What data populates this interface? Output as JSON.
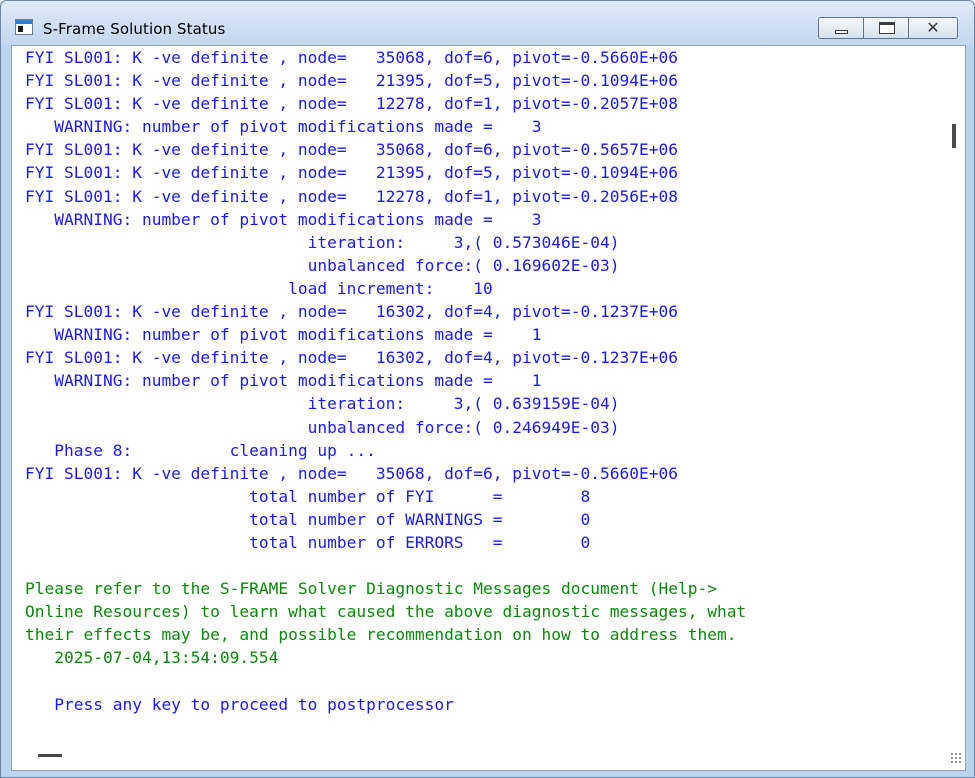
{
  "window": {
    "title": "S-Frame Solution Status"
  },
  "controls": {
    "minimize_icon": "minimize-icon",
    "maximize_icon": "maximize-icon",
    "close_icon": "close-icon",
    "close_glyph": "✕"
  },
  "colors": {
    "console_blue": "#1a1aff",
    "console_green": "#0a8a0a"
  },
  "console": {
    "lines": [
      {
        "text": "FYI SL001: K -ve definite , node=   35068, dof=6, pivot=-0.5660E+06",
        "color": "blue"
      },
      {
        "text": "FYI SL001: K -ve definite , node=   21395, dof=5, pivot=-0.1094E+06",
        "color": "blue"
      },
      {
        "text": "FYI SL001: K -ve definite , node=   12278, dof=1, pivot=-0.2057E+08",
        "color": "blue"
      },
      {
        "text": "   WARNING: number of pivot modifications made =    3",
        "color": "blue"
      },
      {
        "text": "FYI SL001: K -ve definite , node=   35068, dof=6, pivot=-0.5657E+06",
        "color": "blue"
      },
      {
        "text": "FYI SL001: K -ve definite , node=   21395, dof=5, pivot=-0.1094E+06",
        "color": "blue"
      },
      {
        "text": "FYI SL001: K -ve definite , node=   12278, dof=1, pivot=-0.2056E+08",
        "color": "blue"
      },
      {
        "text": "   WARNING: number of pivot modifications made =    3",
        "color": "blue"
      },
      {
        "text": "                             iteration:     3,( 0.573046E-04)",
        "color": "blue"
      },
      {
        "text": "                             unbalanced force:( 0.169602E-03)",
        "color": "blue"
      },
      {
        "text": "                           load increment:    10",
        "color": "blue"
      },
      {
        "text": "FYI SL001: K -ve definite , node=   16302, dof=4, pivot=-0.1237E+06",
        "color": "blue"
      },
      {
        "text": "   WARNING: number of pivot modifications made =    1",
        "color": "blue"
      },
      {
        "text": "FYI SL001: K -ve definite , node=   16302, dof=4, pivot=-0.1237E+06",
        "color": "blue"
      },
      {
        "text": "   WARNING: number of pivot modifications made =    1",
        "color": "blue"
      },
      {
        "text": "                             iteration:     3,( 0.639159E-04)",
        "color": "blue"
      },
      {
        "text": "                             unbalanced force:( 0.246949E-03)",
        "color": "blue"
      },
      {
        "text": "   Phase 8:          cleaning up ...",
        "color": "blue"
      },
      {
        "text": "FYI SL001: K -ve definite , node=   35068, dof=6, pivot=-0.5660E+06",
        "color": "blue"
      },
      {
        "text": "                       total number of FYI      =        8",
        "color": "blue"
      },
      {
        "text": "                       total number of WARNINGS =        0",
        "color": "blue"
      },
      {
        "text": "                       total number of ERRORS   =        0",
        "color": "blue"
      },
      {
        "text": "",
        "color": "blue"
      },
      {
        "text": "Please refer to the S-FRAME Solver Diagnostic Messages document (Help->",
        "color": "green"
      },
      {
        "text": "Online Resources) to learn what caused the above diagnostic messages, what",
        "color": "green"
      },
      {
        "text": "their effects may be, and possible recommendation on how to address them.",
        "color": "green"
      },
      {
        "text": "   2025-07-04,13:54:09.554",
        "color": "green"
      },
      {
        "text": "",
        "color": "blue"
      },
      {
        "text": "   Press any key to proceed to postprocessor",
        "color": "blue"
      }
    ]
  }
}
